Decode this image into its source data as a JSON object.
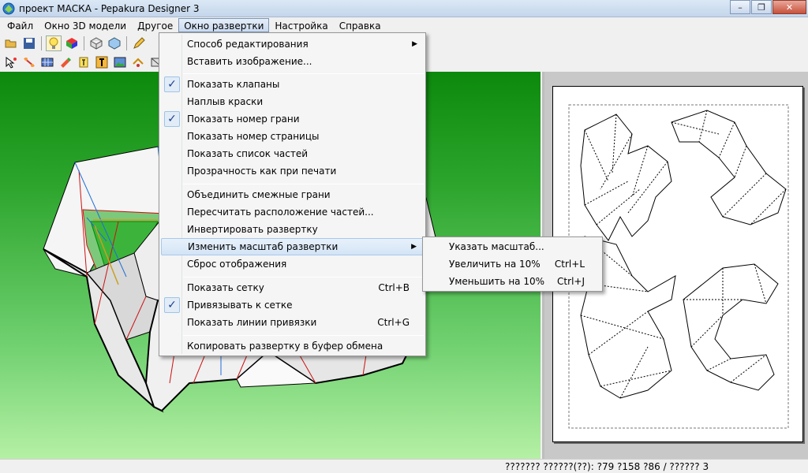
{
  "window": {
    "title": "проект МАСКА - Pepakura Designer 3",
    "minimize_glyph": "–",
    "maximize_glyph": "❐",
    "close_glyph": "✕"
  },
  "menubar": {
    "items": [
      "Файл",
      "Окно 3D модели",
      "Другое",
      "Окно развертки",
      "Настройка",
      "Справка"
    ],
    "active": "Окно развертки"
  },
  "dropdown": {
    "items": [
      {
        "label": "Способ редактирования",
        "submenu": true
      },
      {
        "label": "Вставить изображение..."
      },
      {
        "label": "Показать клапаны",
        "checked": true
      },
      {
        "label": "Наплыв краски"
      },
      {
        "label": "Показать номер грани",
        "checked": true
      },
      {
        "label": "Показать номер страницы"
      },
      {
        "label": "Показать список частей"
      },
      {
        "label": "Прозрачность как при печати"
      },
      {
        "label": "Объединить смежные грани"
      },
      {
        "label": "Пересчитать расположение частей..."
      },
      {
        "label": "Инвертировать развертку"
      },
      {
        "label": "Изменить масштаб развертки",
        "submenu": true,
        "highlighted": true
      },
      {
        "label": "Сброс отображения"
      },
      {
        "label": "Показать сетку",
        "shortcut": "Ctrl+B"
      },
      {
        "label": "Привязывать к сетке",
        "checked": true
      },
      {
        "label": "Показать линии привязки",
        "shortcut": "Ctrl+G"
      },
      {
        "label": "Копировать развертку в буфер обмена"
      }
    ],
    "check_glyph": "✓",
    "submenu_arrow": "▶"
  },
  "submenu": {
    "items": [
      {
        "label": "Указать масштаб...",
        "shortcut": ""
      },
      {
        "label": "Увеличить на 10%",
        "shortcut": "Ctrl+L"
      },
      {
        "label": "Уменьшить на 10%",
        "shortcut": "Ctrl+J"
      }
    ]
  },
  "statusbar": {
    "text": "??????? ??????(??): ?79 ?158 ?86 / ?????? 3"
  },
  "colors": {
    "view_bg_top": "#0c8a0c",
    "view_bg_bottom": "#b5f0a5",
    "paper_bg": "#c8c8c8",
    "menu_highlight": "#d4e4f6"
  }
}
